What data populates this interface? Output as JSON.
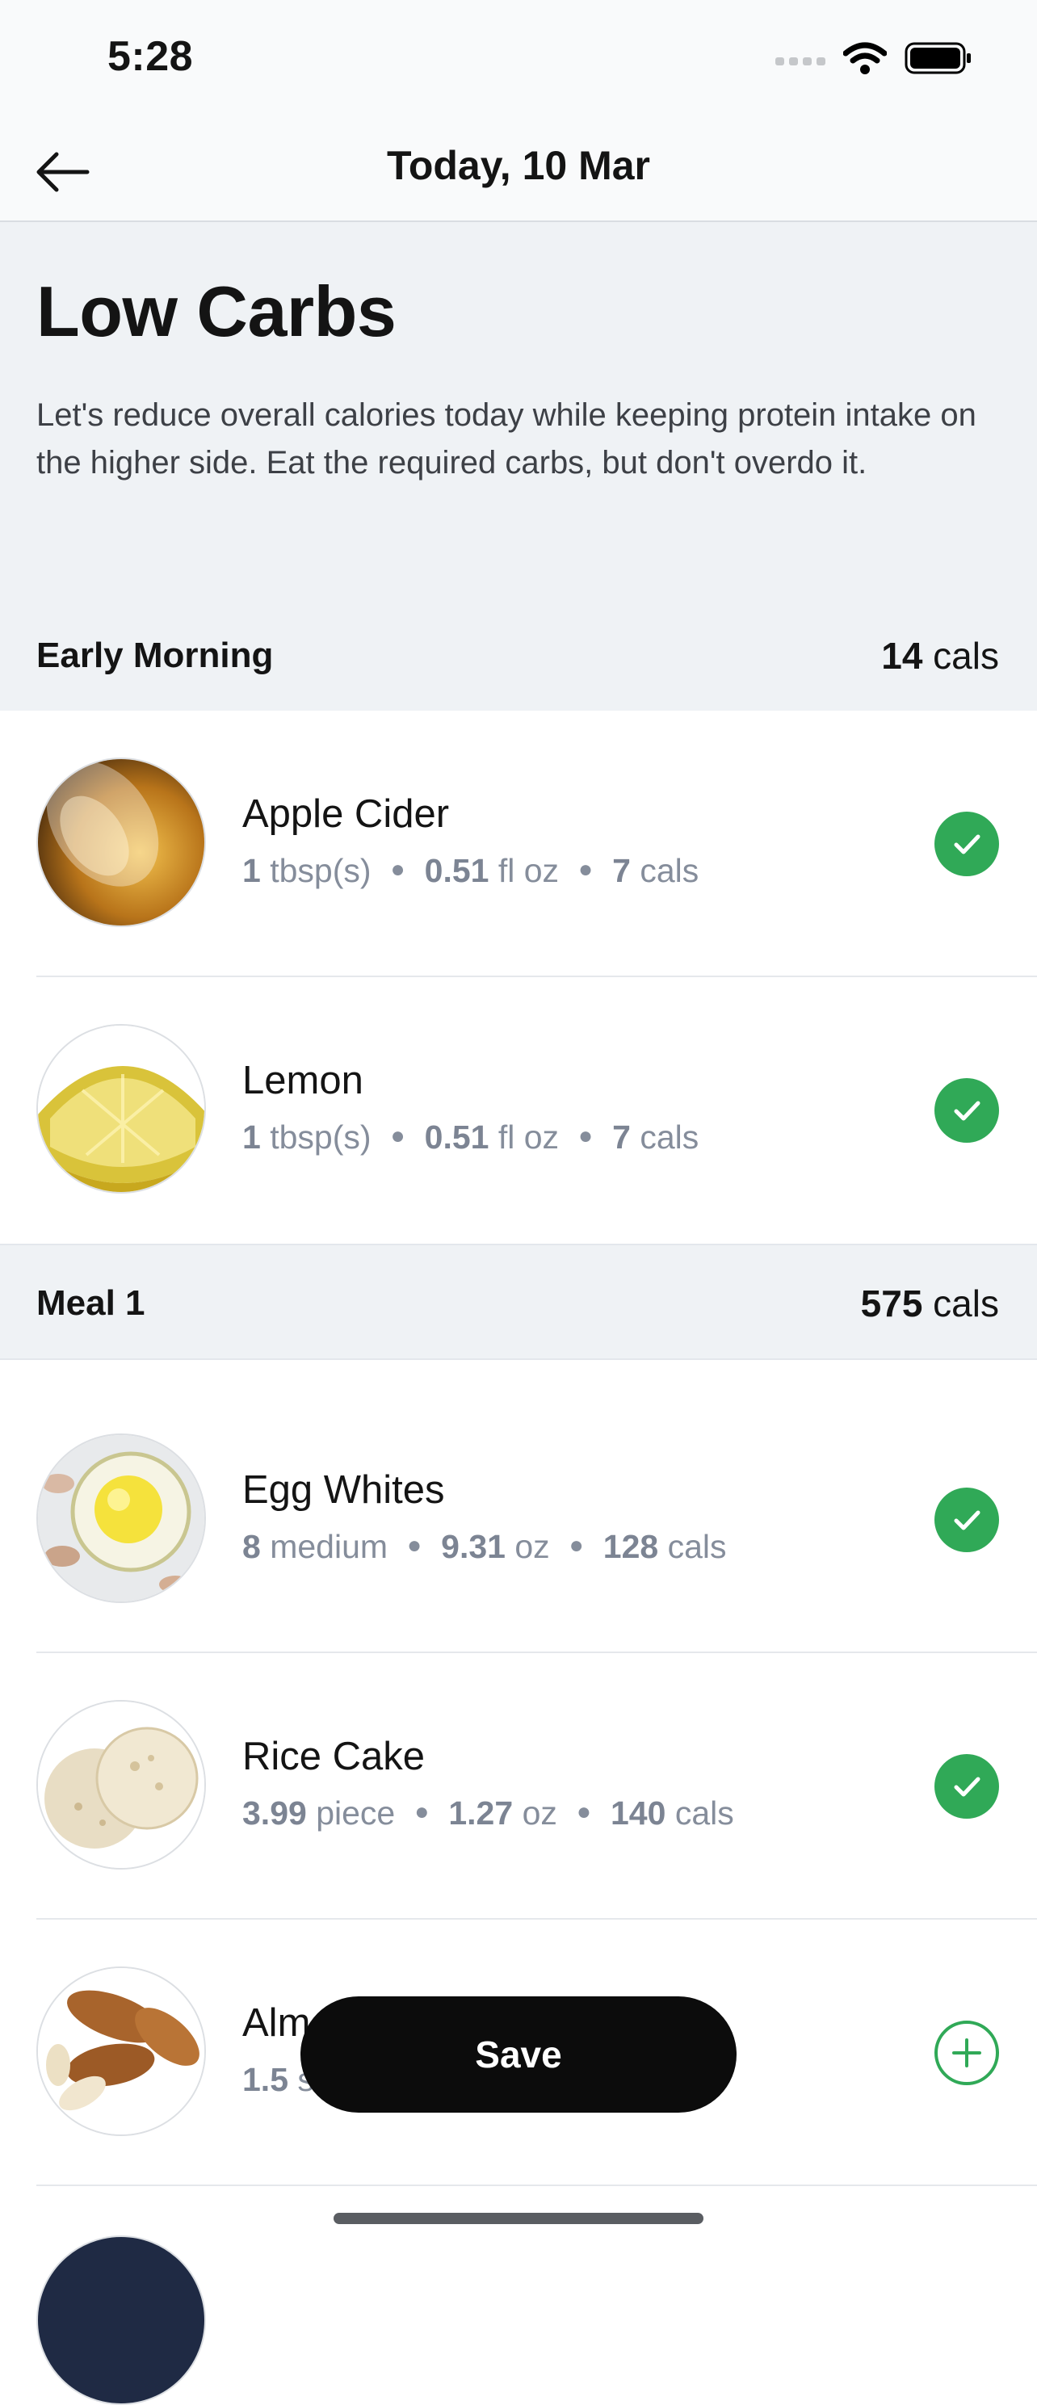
{
  "status_bar": {
    "time": "5:28",
    "icons": [
      "signal-icon",
      "wifi-icon",
      "battery-icon"
    ]
  },
  "nav": {
    "title": "Today, 10 Mar",
    "back_icon": "arrow-left-icon"
  },
  "plan": {
    "title": "Low Carbs",
    "description": "Let's reduce overall calories today while keeping protein intake on the higher side. Eat the required carbs, but don't overdo it."
  },
  "sections": [
    {
      "name": "Early Morning",
      "cals_value": "14",
      "cals_unit": " cals",
      "items": [
        {
          "name": "Apple Cider",
          "qty": "1",
          "qty_unit": " tbsp(s)",
          "weight": "0.51",
          "weight_unit": " fl oz",
          "cals": "7",
          "cals_unit": " cals",
          "status": "done"
        },
        {
          "name": "Lemon",
          "qty": "1",
          "qty_unit": " tbsp(s)",
          "weight": "0.51",
          "weight_unit": " fl oz",
          "cals": "7",
          "cals_unit": " cals",
          "status": "done"
        }
      ]
    },
    {
      "name": "Meal 1",
      "cals_value": "575",
      "cals_unit": " cals",
      "items": [
        {
          "name": "Egg Whites",
          "qty": "8",
          "qty_unit": " medium",
          "weight": "9.31",
          "weight_unit": " oz",
          "cals": "128",
          "cals_unit": " cals",
          "status": "done"
        },
        {
          "name": "Rice Cake",
          "qty": "3.99",
          "qty_unit": " piece",
          "weight": "1.27",
          "weight_unit": " oz",
          "cals": "140",
          "cals_unit": " cals",
          "status": "done"
        },
        {
          "name": "Alm",
          "qty": "1.5",
          "qty_unit": " s",
          "weight": "",
          "weight_unit": "",
          "cals": "",
          "cals_unit": "s",
          "status": "add"
        }
      ]
    }
  ],
  "save_button": {
    "label": "Save"
  },
  "colors": {
    "accent_green": "#30a957",
    "section_bg": "#eff2f5",
    "meta_text": "#858d9b"
  }
}
